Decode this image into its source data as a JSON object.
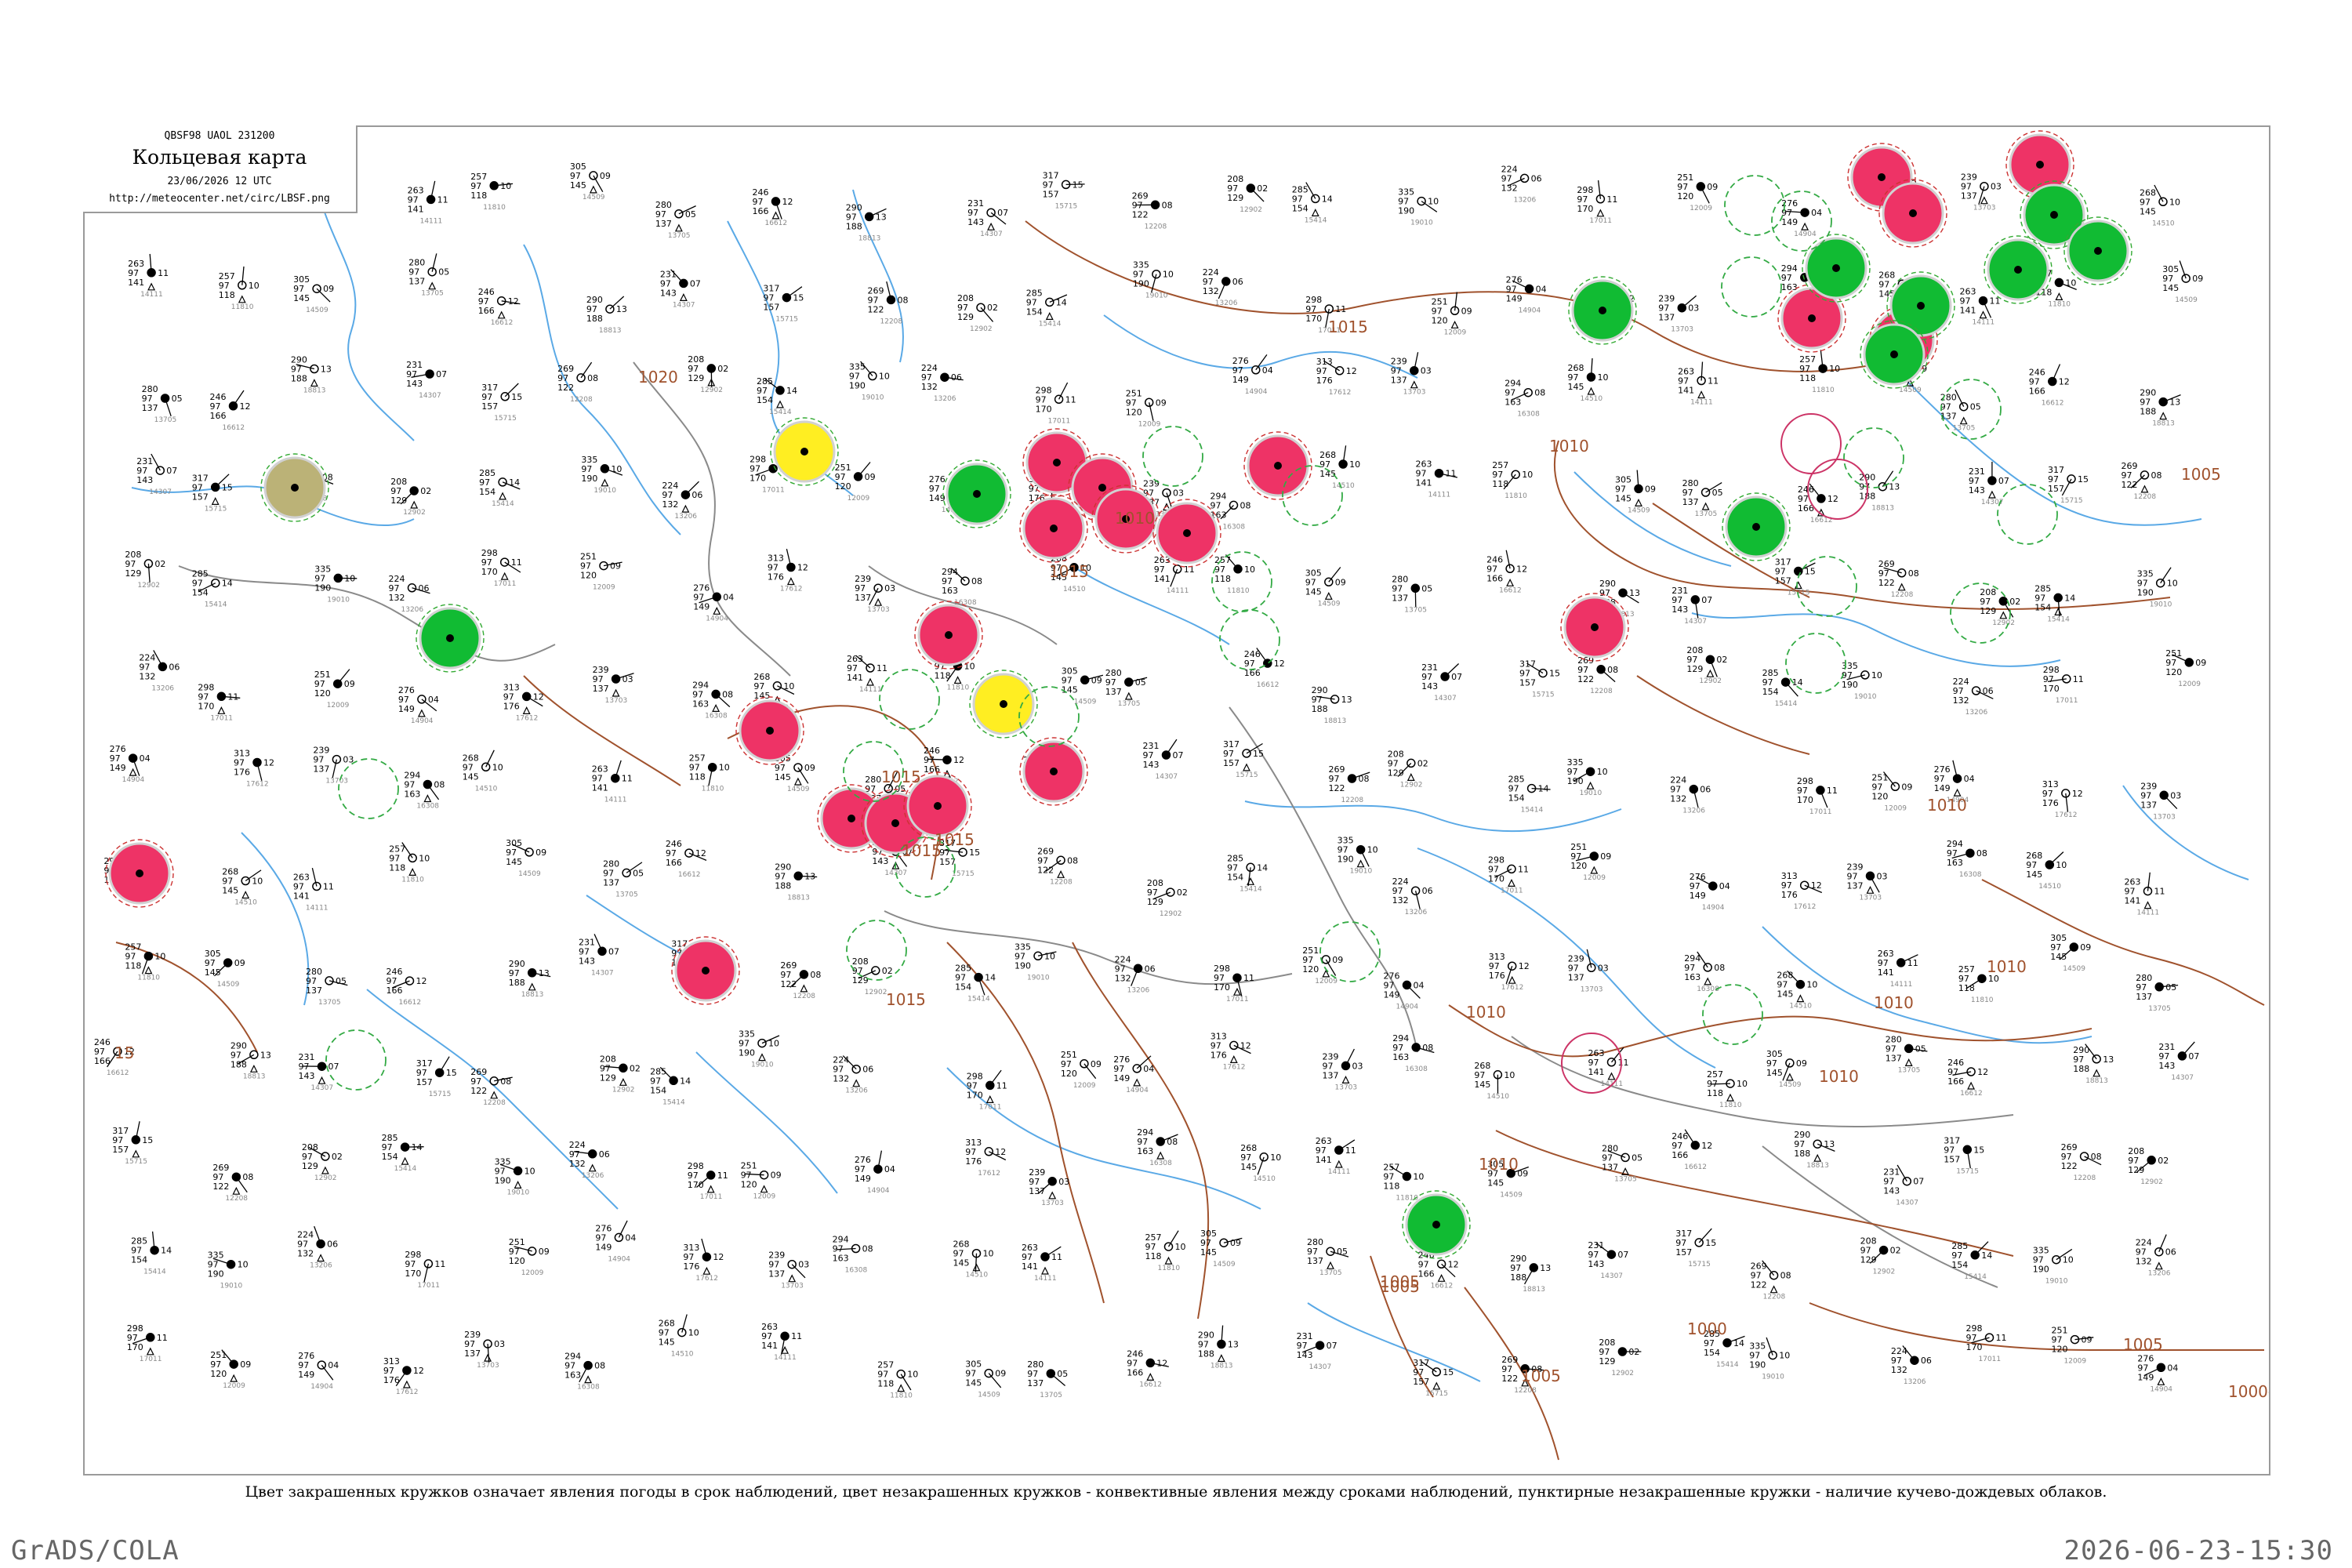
{
  "header": {
    "station_code": "QBSF98   UAOL   231200",
    "title": "Кольцевая карта",
    "time": "23/06/2026 12 UTC",
    "url": "http://meteocenter.net/circ/LBSF.png"
  },
  "caption": "Цвет закрашенных кружков означает явления погоды в срок наблюдений, цвет незакрашенных кружков - конвективные явления между сроками наблюдений, пунктирные незакрашенные кружки - наличие кучево-дождевых облаков.",
  "footer": {
    "left": "GrADS/COLA",
    "right": "2026-06-23-15:30"
  },
  "colors": {
    "thunderstorm": "#ee3366",
    "rain_shower": "#11bb33",
    "fog_haze": "#ffee22",
    "dust": "#bbb277",
    "cb_ring": "#33aa44",
    "isobar": "#a0522d",
    "river": "#5aa9e6",
    "border": "#8a8a8a"
  },
  "isobar_labels": [
    "1015",
    "1015",
    "1010",
    "1010",
    "1010",
    "1010",
    "1015",
    "1015",
    "1015",
    "1010",
    "1010",
    "1010",
    "1010",
    "1005",
    "1005",
    "1005",
    "1005",
    "1000",
    "1000-",
    "15",
    "1020",
    "1015",
    "1005"
  ],
  "station_samples": [
    {
      "t": "263",
      "p": "97",
      "d": "11",
      "n": "141"
    },
    {
      "t": "257",
      "p": "97",
      "d": "10",
      "n": "118"
    },
    {
      "t": "305",
      "p": "97",
      "d": "09",
      "n": "145"
    },
    {
      "t": "280",
      "p": "97",
      "d": "05",
      "n": "137"
    },
    {
      "t": "246",
      "p": "97",
      "d": "12",
      "n": "166"
    },
    {
      "t": "290",
      "p": "97",
      "d": "13",
      "n": "188"
    },
    {
      "t": "231",
      "p": "97",
      "d": "07",
      "n": "143"
    },
    {
      "t": "317",
      "p": "97",
      "d": "15",
      "n": "157"
    },
    {
      "t": "269",
      "p": "97",
      "d": "08",
      "n": "122"
    },
    {
      "t": "208",
      "p": "97",
      "d": "02",
      "n": "129"
    },
    {
      "t": "285",
      "p": "97",
      "d": "14",
      "n": "154"
    },
    {
      "t": "335",
      "p": "97",
      "d": "10",
      "n": "190"
    },
    {
      "t": "224",
      "p": "97",
      "d": "06",
      "n": "132"
    },
    {
      "t": "298",
      "p": "97",
      "d": "11",
      "n": "170"
    },
    {
      "t": "251",
      "p": "97",
      "d": "09",
      "n": "120"
    },
    {
      "t": "276",
      "p": "97",
      "d": "04",
      "n": "149"
    },
    {
      "t": "313",
      "p": "97",
      "d": "12",
      "n": "176"
    },
    {
      "t": "239",
      "p": "97",
      "d": "03",
      "n": "137"
    },
    {
      "t": "294",
      "p": "97",
      "d": "08",
      "n": "163"
    },
    {
      "t": "268",
      "p": "97",
      "d": "10",
      "n": "145"
    }
  ]
}
